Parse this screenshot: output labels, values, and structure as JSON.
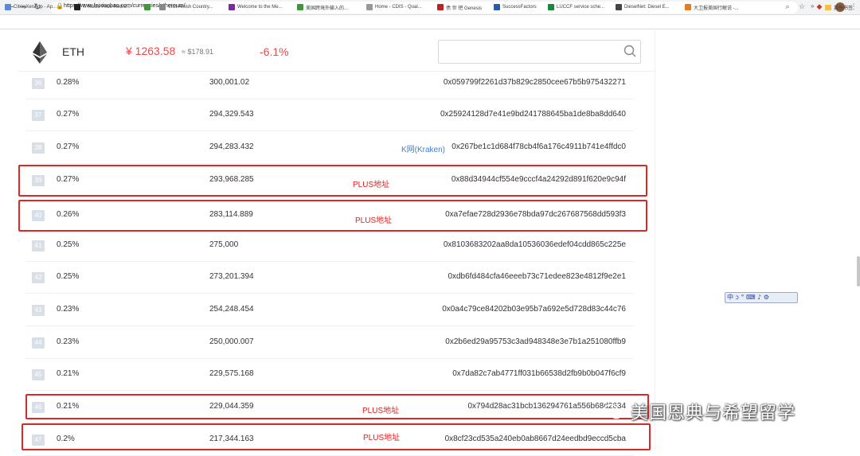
{
  "browser": {
    "url": "https://www.feixiaohao.com/currencies/ethereum/",
    "bookmarks": [
      {
        "label": "Citrix XenApp - Ap...",
        "color": "#5b8bd6"
      },
      {
        "label": "T. Rowe Price Retire...",
        "color": "#222222"
      },
      {
        "label": "",
        "color": "#3a9a3a"
      },
      {
        "label": "Visit Amish Country...",
        "color": "#888888"
      },
      {
        "label": "Welcome to the Me...",
        "color": "#7a2a9a"
      },
      {
        "label": "美国跨境外输入的...",
        "color": "#3a9a3a"
      },
      {
        "label": "Home - CDIS - Qual...",
        "color": "#999999"
      },
      {
        "label": "债 世 钯 Genesis",
        "color": "#c02020"
      },
      {
        "label": "SuccessFactors",
        "color": "#2a5aa8"
      },
      {
        "label": "LUCCF service sche...",
        "color": "#1a8a3a"
      },
      {
        "label": "DieselNet: Diesel E...",
        "color": "#444444"
      },
      {
        "label": "大卫报美国行解说 -...",
        "color": "#e87a20"
      }
    ],
    "bookmarks_more": "»",
    "other_bookmarks": "其他书签"
  },
  "coin": {
    "symbol": "ETH",
    "price_cny": "¥ 1263.58",
    "price_usd": "≈ $178.91",
    "change": "-6.1%"
  },
  "search": {
    "placeholder": ""
  },
  "holders": [
    {
      "rank": "36",
      "pct": "0.28%",
      "qty": "300,001.02",
      "label": "",
      "address": "0x059799f2261d37b829c2850cee67b5b975432271"
    },
    {
      "rank": "37",
      "pct": "0.27%",
      "qty": "294,329.543",
      "label": "",
      "address": "0x25924128d7e41e9bd241788645ba1de8ba8dd640"
    },
    {
      "rank": "38",
      "pct": "0.27%",
      "qty": "294,283.432",
      "label": "K网(Kraken)",
      "address": "0x267be1c1d684f78cb4f6a176c4911b741e4ffdc0"
    },
    {
      "rank": "39",
      "pct": "0.27%",
      "qty": "293,968.285",
      "label": "",
      "address": "0x88d34944cf554e9cccf4a24292d891f620e9c94f"
    },
    {
      "rank": "40",
      "pct": "0.26%",
      "qty": "283,114.889",
      "label": "",
      "address": "0xa7efae728d2936e78bda97dc267687568dd593f3"
    },
    {
      "rank": "41",
      "pct": "0.25%",
      "qty": "275,000",
      "label": "",
      "address": "0x8103683202aa8da10536036edef04cdd865c225e"
    },
    {
      "rank": "42",
      "pct": "0.25%",
      "qty": "273,201.394",
      "label": "",
      "address": "0xdb6fd484cfa46eeeb73c71edee823e4812f9e2e1"
    },
    {
      "rank": "43",
      "pct": "0.23%",
      "qty": "254,248.454",
      "label": "",
      "address": "0x0a4c79ce84202b03e95b7a692e5d728d83c44c76"
    },
    {
      "rank": "44",
      "pct": "0.23%",
      "qty": "250,000.007",
      "label": "",
      "address": "0x2b6ed29a95753c3ad948348e3e7b1a251080ffb9"
    },
    {
      "rank": "45",
      "pct": "0.21%",
      "qty": "229,575.168",
      "label": "",
      "address": "0x7da82c7ab4771ff031b66538d2fb9b0b047f6cf9"
    },
    {
      "rank": "46",
      "pct": "0.21%",
      "qty": "229,044.359",
      "label": "",
      "address": "0x794d28ac31bcb136294761a556b68d2634"
    },
    {
      "rank": "47",
      "pct": "0.2%",
      "qty": "217,344.163",
      "label": "",
      "address": "0x8cf23cd535a240eb0ab8667d24eedbd9eccd5cba"
    }
  ],
  "annotations": {
    "plus_label": "PLUS地址"
  },
  "ime_toolbar": "中 ↄ ° ⌨ ♪ ⚙",
  "watermark": "美国恩典与希望留学",
  "colors": {
    "price_red": "#e84a4a",
    "highlight_red": "#d82828",
    "label_blue": "#3b7ddd",
    "rank_badge": "#d9dfe6"
  }
}
